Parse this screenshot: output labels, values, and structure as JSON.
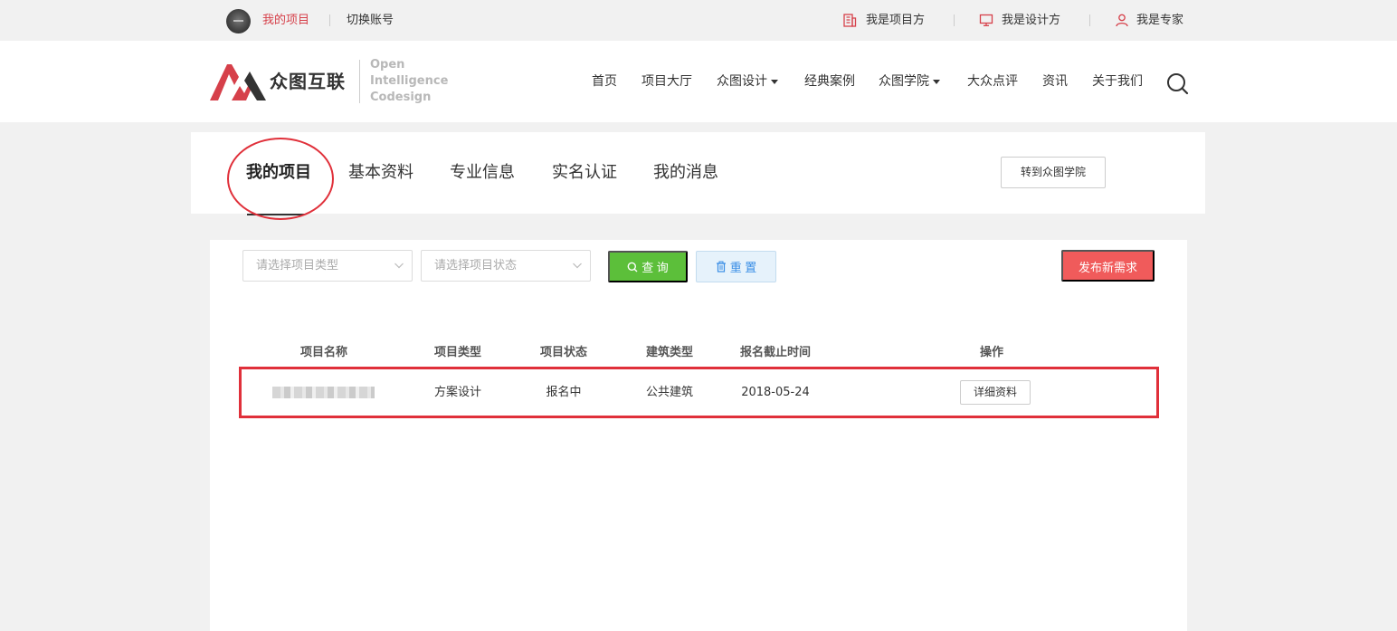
{
  "topbar": {
    "my_projects": "我的项目",
    "switch_account": "切换账号",
    "project_owner": "我是项目方",
    "designer": "我是设计方",
    "expert": "我是专家"
  },
  "header": {
    "brand_cn": "众图互联",
    "brand_en": [
      "Open",
      "Intelligence",
      "Codesign"
    ],
    "nav": [
      "首页",
      "项目大厅",
      "众图设计",
      "经典案例",
      "众图学院",
      "大众点评",
      "资讯",
      "关于我们"
    ]
  },
  "tabs": {
    "items": [
      "我的项目",
      "基本资料",
      "专业信息",
      "实名认证",
      "我的消息"
    ],
    "goto_academy": "转到众图学院"
  },
  "filters": {
    "type_placeholder": "请选择项目类型",
    "status_placeholder": "请选择项目状态",
    "query_label": "查 询",
    "reset_label": "重 置",
    "publish_label": "发布新需求"
  },
  "table": {
    "headers": [
      "项目名称",
      "项目类型",
      "项目状态",
      "建筑类型",
      "报名截止时间",
      "操作"
    ],
    "rows": [
      {
        "type": "方案设计",
        "status": "报名中",
        "building": "公共建筑",
        "deadline": "2018-05-24",
        "action": "详细资料"
      }
    ]
  },
  "colors": {
    "accent_red": "#d6404a",
    "query_green": "#5cbf3a",
    "publish_red": "#f05b5b",
    "reset_blue": "#3a8ee6"
  }
}
